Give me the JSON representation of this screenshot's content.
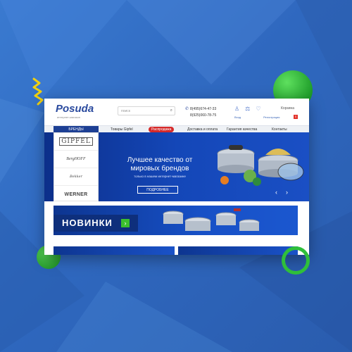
{
  "header": {
    "logo": "Posuda",
    "logo_sub": "интернет-магазин",
    "search_placeholder": "поиск",
    "phones": [
      "8(495)674-47-33",
      "8(925)060-78-75"
    ],
    "link_enter": "Вход",
    "link_register": "Регистрация",
    "cart_label": "Корзина",
    "cart_count": "0"
  },
  "nav": {
    "brands": "БРЕНДЫ",
    "items": [
      "Товары Gipfel",
      "Распродажа",
      "Доставка и оплата",
      "Гарантия качества",
      "Контакты"
    ]
  },
  "brands": [
    "GIPFEL",
    "BergHOFF",
    "Bekker",
    "WERNER"
  ],
  "hero": {
    "title": "Лучшее качество от мировых брендов",
    "subtitle": "только в нашем интернет-магазине",
    "button": "ПОДРОБНЕЕ"
  },
  "news": {
    "label": "НОВИНКИ"
  },
  "colors": {
    "brand_blue": "#1d3f94",
    "sale_red": "#d62a2a",
    "accent_green": "#3bbf2d",
    "background": "#2f68bf"
  }
}
